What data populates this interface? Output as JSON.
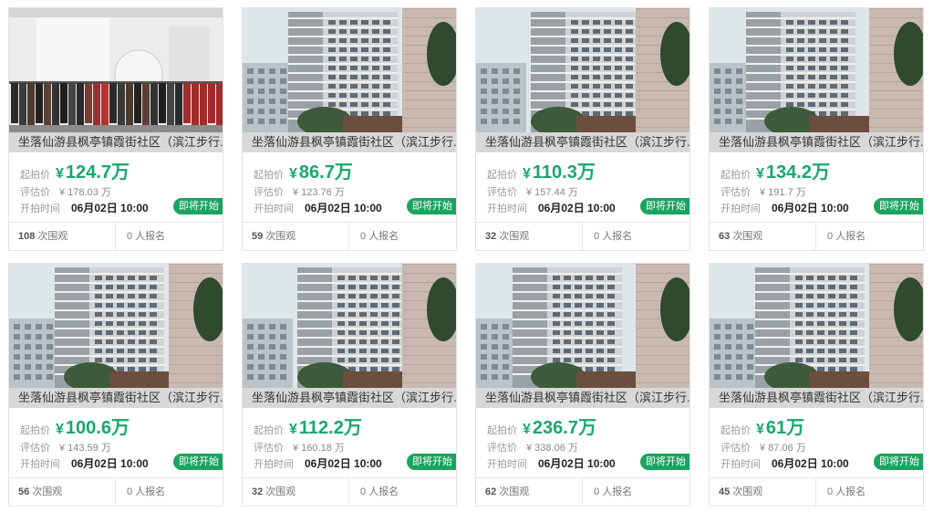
{
  "labels": {
    "start_price": "起拍价",
    "estimate": "评估价",
    "start_time": "开拍时间",
    "views_suffix": "次围观",
    "signups_suffix": "人报名",
    "yen": "¥"
  },
  "colors": {
    "price_green": "#17a86b",
    "badge_green": "#1aa45e",
    "title_bar": "#d8d8d8"
  },
  "listings": [
    {
      "title": "坐落仙游县枫亭镇霞街社区（滨江步行...",
      "price": "124.7万",
      "estimate": "¥ 178.03 万",
      "time": "06月02日 10:00",
      "badge": "即将开始",
      "views": "108",
      "signups": "0",
      "photo": "clothing-store"
    },
    {
      "title": "坐落仙游县枫亭镇霞街社区（滨江步行...",
      "price": "86.7万",
      "estimate": "¥ 123.76 万",
      "time": "06月02日 10:00",
      "badge": "即将开始",
      "views": "59",
      "signups": "0",
      "photo": "apartment-building"
    },
    {
      "title": "坐落仙游县枫亭镇霞街社区（滨江步行...",
      "price": "110.3万",
      "estimate": "¥ 157.44 万",
      "time": "06月02日 10:00",
      "badge": "即将开始",
      "views": "32",
      "signups": "0",
      "photo": "apartment-building"
    },
    {
      "title": "坐落仙游县枫亭镇霞街社区（滨江步行...",
      "price": "134.2万",
      "estimate": "¥ 191.7 万",
      "time": "06月02日 10:00",
      "badge": "即将开始",
      "views": "63",
      "signups": "0",
      "photo": "apartment-building"
    },
    {
      "title": "坐落仙游县枫亭镇霞街社区（滨江步行...",
      "price": "100.6万",
      "estimate": "¥ 143.59 万",
      "time": "06月02日 10:00",
      "badge": "即将开始",
      "views": "56",
      "signups": "0",
      "photo": "apartment-building"
    },
    {
      "title": "坐落仙游县枫亭镇霞街社区（滨江步行...",
      "price": "112.2万",
      "estimate": "¥ 160.18 万",
      "time": "06月02日 10:00",
      "badge": "即将开始",
      "views": "32",
      "signups": "0",
      "photo": "apartment-building"
    },
    {
      "title": "坐落仙游县枫亭镇霞街社区（滨江步行...",
      "price": "236.7万",
      "estimate": "¥ 338.06 万",
      "time": "06月02日 10:00",
      "badge": "即将开始",
      "views": "62",
      "signups": "0",
      "photo": "apartment-building"
    },
    {
      "title": "坐落仙游县枫亭镇霞街社区（滨江步行...",
      "price": "61万",
      "estimate": "¥ 87.06 万",
      "time": "06月02日 10:00",
      "badge": "即将开始",
      "views": "45",
      "signups": "0",
      "photo": "apartment-building"
    }
  ]
}
